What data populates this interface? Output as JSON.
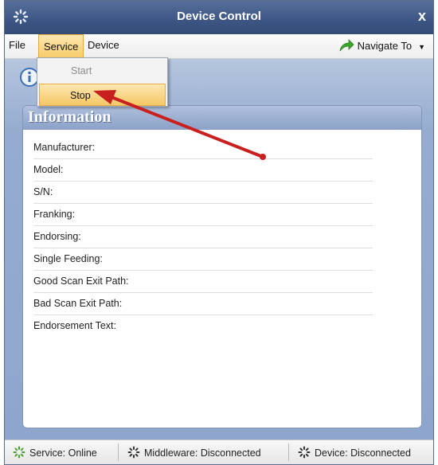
{
  "window": {
    "title": "Device Control",
    "close_glyph": "x",
    "app_icon": "spinner-icon"
  },
  "menubar": {
    "file": "File",
    "service": "Service",
    "device": "Device",
    "navigate_to": "Navigate To",
    "navigate_icon": "green-arrow-icon"
  },
  "service_menu": {
    "start": "Start",
    "stop": "Stop"
  },
  "panel": {
    "title": "Information",
    "fields": [
      "Manufacturer:",
      "Model:",
      "S/N:",
      "Franking:",
      "Endorsing:",
      "Single Feeding:",
      "Good Scan Exit Path:",
      "Bad Scan Exit Path:",
      "Endorsement Text:"
    ]
  },
  "status": {
    "service": "Service: Online",
    "middleware": "Middleware: Disconnected",
    "device": "Device: Disconnected"
  },
  "colors": {
    "titlebar": "#3c5583",
    "highlight": "#f8cc6a",
    "annotation_arrow": "#c8201e",
    "online_green": "#4aa52e"
  }
}
